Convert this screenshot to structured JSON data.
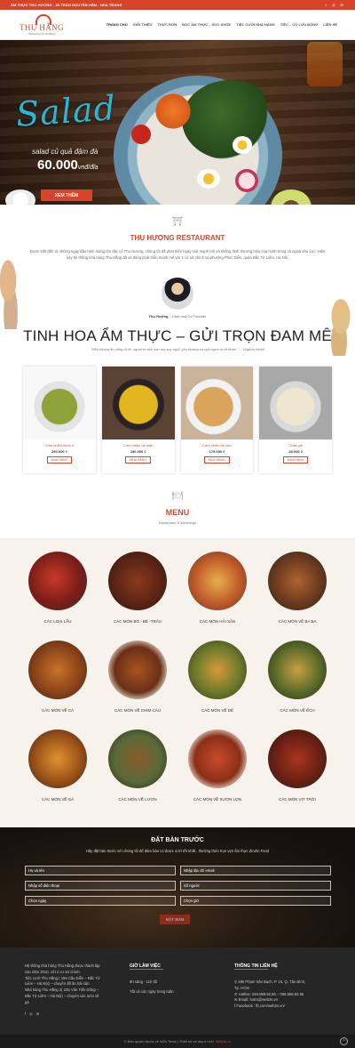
{
  "topbar": {
    "message": "ẨM THỰC THU HƯƠNG - 35 TRẦN NGUYÊN HÃN - NHA TRANG",
    "socials": [
      "f",
      "◎",
      "✉"
    ]
  },
  "logo": {
    "name": "THU HẰNG",
    "tagline": "Restaurant & Wedding"
  },
  "nav": [
    "TRANG CHỦ",
    "GIỚI THIỆU",
    "THỰC ĐƠN",
    "ĐỌC ẨM THỰC – SỨC KHỎE",
    "TIỆC CƯỚI NHÀ HÀNG",
    "TIỆC – CỖ LƯU ĐỘNG",
    "LIÊN HỆ"
  ],
  "hero": {
    "script": "Salad",
    "sub": "salad củ quả đậm đà",
    "price": "60.000",
    "unit": "vnđ/đĩa",
    "button": "XEM THÊM"
  },
  "about": {
    "title": "THU HƯƠNG RESTAURANT",
    "desc": "Được biết đến từ những ngày đầu hàm mang tên đặc cổ Thu Hương, chúng tôi đã phát triển ngày một mạnh mẽ và khẳng định thương hiệu của mình trong và ngoài khu vực. Hiện nay hệ thống nhà hàng Thu Hằng đã và đang phát triển mạnh mẽ với 2 cơ sở chính tại phường Phúc Diễn, quận Bắc Từ Liêm, Hà Nội.",
    "person": "Thu Hương",
    "role": "– Chef and Co Founder",
    "headline": "TINH HOA ẨM THỰC – GỬI TRỌN ĐAM MÊ",
    "quote": "\"Nếu không ăn uống tử tế, người ta làm sao mà suy nghĩ, yêu đương và ngủ ngon tử tế được.\" – Virginia Woolf"
  },
  "dishes": [
    {
      "name": "Cơm chiên muối ớ",
      "price": "250.000 ₫",
      "btn": "MUA HÀNG"
    },
    {
      "name": "Cơm chiên cá mặn",
      "price": "150.000 ₫",
      "btn": "MUA HÀNG"
    },
    {
      "name": "Cơm chiên bò cầu",
      "price": "175.000 ₫",
      "btn": "MUA HÀNG"
    },
    {
      "name": "Cháo gà",
      "price": "45.000 ₫",
      "btn": "MUA HÀNG"
    }
  ],
  "menu": {
    "title": "MENU",
    "subtitle": "Restaurant & Weddings",
    "items": [
      "CÁC LOẠI LẨU",
      "CÁC MÓN BÒ - BÊ -TRÂU",
      "CÁC MÓN HẢI SẢN",
      "CÁC MÓN VỀ BA BA",
      "CÁC MÓN VỀ CÁ",
      "CÁC MÓN VỀ CHIM CÂU",
      "CÁC MÓN VỀ DÊ",
      "CÁC MÓN VỀ ẾCH",
      "CÁC MÓN VỀ GÀ",
      "CÁC MÓN VỀ LƯƠN",
      "CÁC MÓN VỀ SƯỜN LỢN",
      "CÁC MÓN VỊT TRỜI"
    ]
  },
  "booking": {
    "title": "ĐẶT BÀN TRƯỚC",
    "subtitle": "Hãy đặt bàn trước với chúng tôi để đảm bảo có được vị trí tốt nhất , thưởng thức trọn vẹn ẩm thực ZinZin Food",
    "fields": {
      "name": "Họ và tên",
      "email": "Nhập địa chỉ email",
      "phone": "Nhập số điện thoại",
      "guests": "Số người",
      "day": "Chọn ngày",
      "time": "Chọn giờ"
    },
    "button": "ĐẶT BÀN"
  },
  "footer": {
    "about": [
      "Hệ thống nhà hàng Thu Hằng được thành lập",
      "vào năm 2010, với 2 cơ sở chính:",
      "Tiệc cưới Thu Hằng ( 159 Cầu Diễn – Bắc Từ",
      "Liêm – Hà Nội) – chuyên đồ ăn hải sản.",
      "Nhà hàng Thu Hằng 2( 235 Văn Tiến Dũng –",
      "Bắc Từ Liêm – Hà Nội) – chuyên các món về",
      "gà"
    ],
    "hours_title": "GIỜ LÀM VIỆC",
    "hours": [
      "6h sáng - 11h tối",
      "Tất cả các ngày trong tuần"
    ],
    "contact_title": "THÔNG TIN LIÊN HỆ",
    "contact": [
      "285 Phạm Văn Bạch, P. 15, Q. Tân Bình,",
      "Tp. HCM",
      "Hotline: 094.969.92.95 – 096.559.92.95",
      "Email: hotro@web2s.vn",
      "Facebook : fb.com/web2s.vn/"
    ],
    "socials": [
      "f",
      "◎",
      "✉"
    ]
  },
  "copyright": {
    "text": "© Bản quyền thuộc về W2s Team | Thiết kế và duy trì bởi",
    "brand": "Web2s.vn"
  }
}
